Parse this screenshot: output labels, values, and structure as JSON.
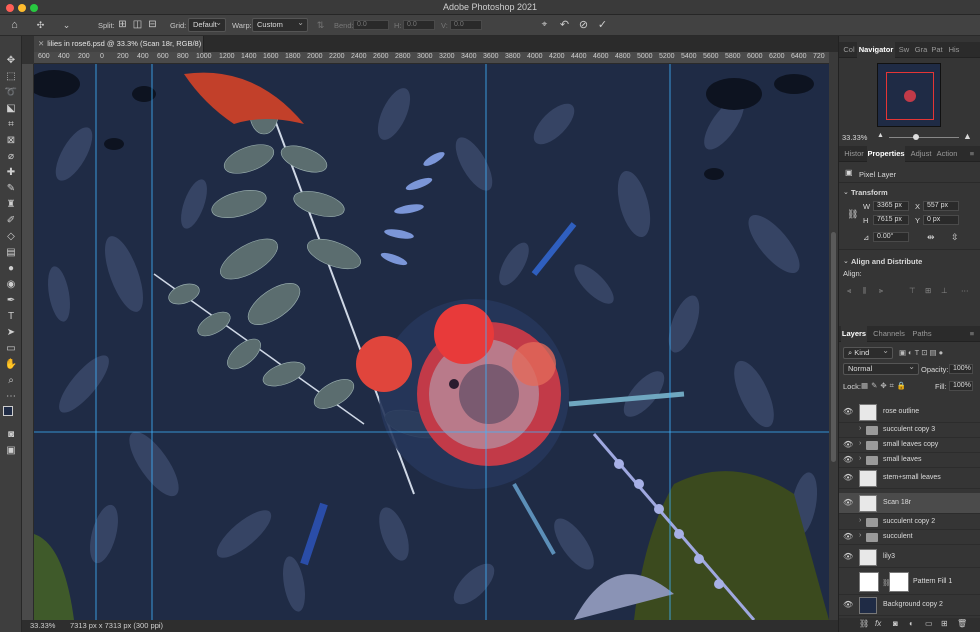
{
  "window": {
    "title": "Adobe Photoshop 2021"
  },
  "options_bar": {
    "split_label": "Split:",
    "grid_label": "Grid:",
    "grid_value": "Default",
    "warp_label": "Warp:",
    "warp_value": "Custom",
    "bend_label": "Bend:",
    "bend_value": "0.0",
    "h_label": "H:",
    "h_value": "0.0",
    "v_label": "V:",
    "v_value": "0.0"
  },
  "document": {
    "tab_title": "lilies in rose6.psd @ 33.3% (Scan 18r, RGB/8) *",
    "ruler_labels": [
      "600",
      "400",
      "200",
      "0",
      "200",
      "400",
      "600",
      "800",
      "1000",
      "1200",
      "1400",
      "1600",
      "1800",
      "2000",
      "2200",
      "2400",
      "2600",
      "2800",
      "3000",
      "3200",
      "3400",
      "3600",
      "3800",
      "4000",
      "4200",
      "4400",
      "4600",
      "4800",
      "5000",
      "5200",
      "5400",
      "5600",
      "5800",
      "6000",
      "6200",
      "6400",
      "6600",
      "6800",
      "7000",
      "720"
    ]
  },
  "status": {
    "zoom": "33.33%",
    "doc_info": "7313 px x 7313 px (300 ppi)"
  },
  "navigator_panel": {
    "tabs": [
      "Col",
      "Navigator",
      "Sw",
      "Gra",
      "Pat",
      "His"
    ],
    "active_tab": "Navigator",
    "zoom": "33.33%"
  },
  "properties_panel": {
    "tabs": [
      "Histor",
      "Properties",
      "Adjust",
      "Action"
    ],
    "active_tab": "Properties",
    "kind": "Pixel Layer",
    "transform_title": "Transform",
    "w_label": "W",
    "w_value": "3365 px",
    "x_label": "X",
    "x_value": "557 px",
    "h_label": "H",
    "h_value": "7615 px",
    "y_label": "Y",
    "y_value": "0 px",
    "angle_value": "0.00°",
    "align_title": "Align and Distribute",
    "align_label": "Align:"
  },
  "layers_panel": {
    "tabs": [
      "Layers",
      "Channels",
      "Paths"
    ],
    "active_tab": "Layers",
    "filter_value": "Kind",
    "blend_mode": "Normal",
    "opacity_label": "Opacity:",
    "opacity_value": "100%",
    "lock_label": "Lock:",
    "fill_label": "Fill:",
    "fill_value": "100%",
    "layers": [
      {
        "name": "rose outline",
        "type": "pixel",
        "visible": true
      },
      {
        "name": "succulent copy 3",
        "type": "group",
        "visible": false
      },
      {
        "name": "small leaves copy",
        "type": "group",
        "visible": true
      },
      {
        "name": "small leaves",
        "type": "group",
        "visible": true
      },
      {
        "name": "stem+small leaves",
        "type": "pixel",
        "visible": true
      },
      {
        "name": "Scan 18r",
        "type": "pixel",
        "visible": true,
        "selected": true
      },
      {
        "name": "succulent copy 2",
        "type": "group",
        "visible": false
      },
      {
        "name": "succulent",
        "type": "group",
        "visible": true
      },
      {
        "name": "lily3",
        "type": "pixel",
        "visible": true
      },
      {
        "name": "Pattern Fill 1",
        "type": "fill",
        "visible": false
      },
      {
        "name": "Background copy 2",
        "type": "pixel",
        "visible": true
      }
    ]
  },
  "colors": {
    "canvas_bg": "#1f2b45",
    "guide": "#3fb4ff",
    "accent_rose": "#e83a3a"
  }
}
